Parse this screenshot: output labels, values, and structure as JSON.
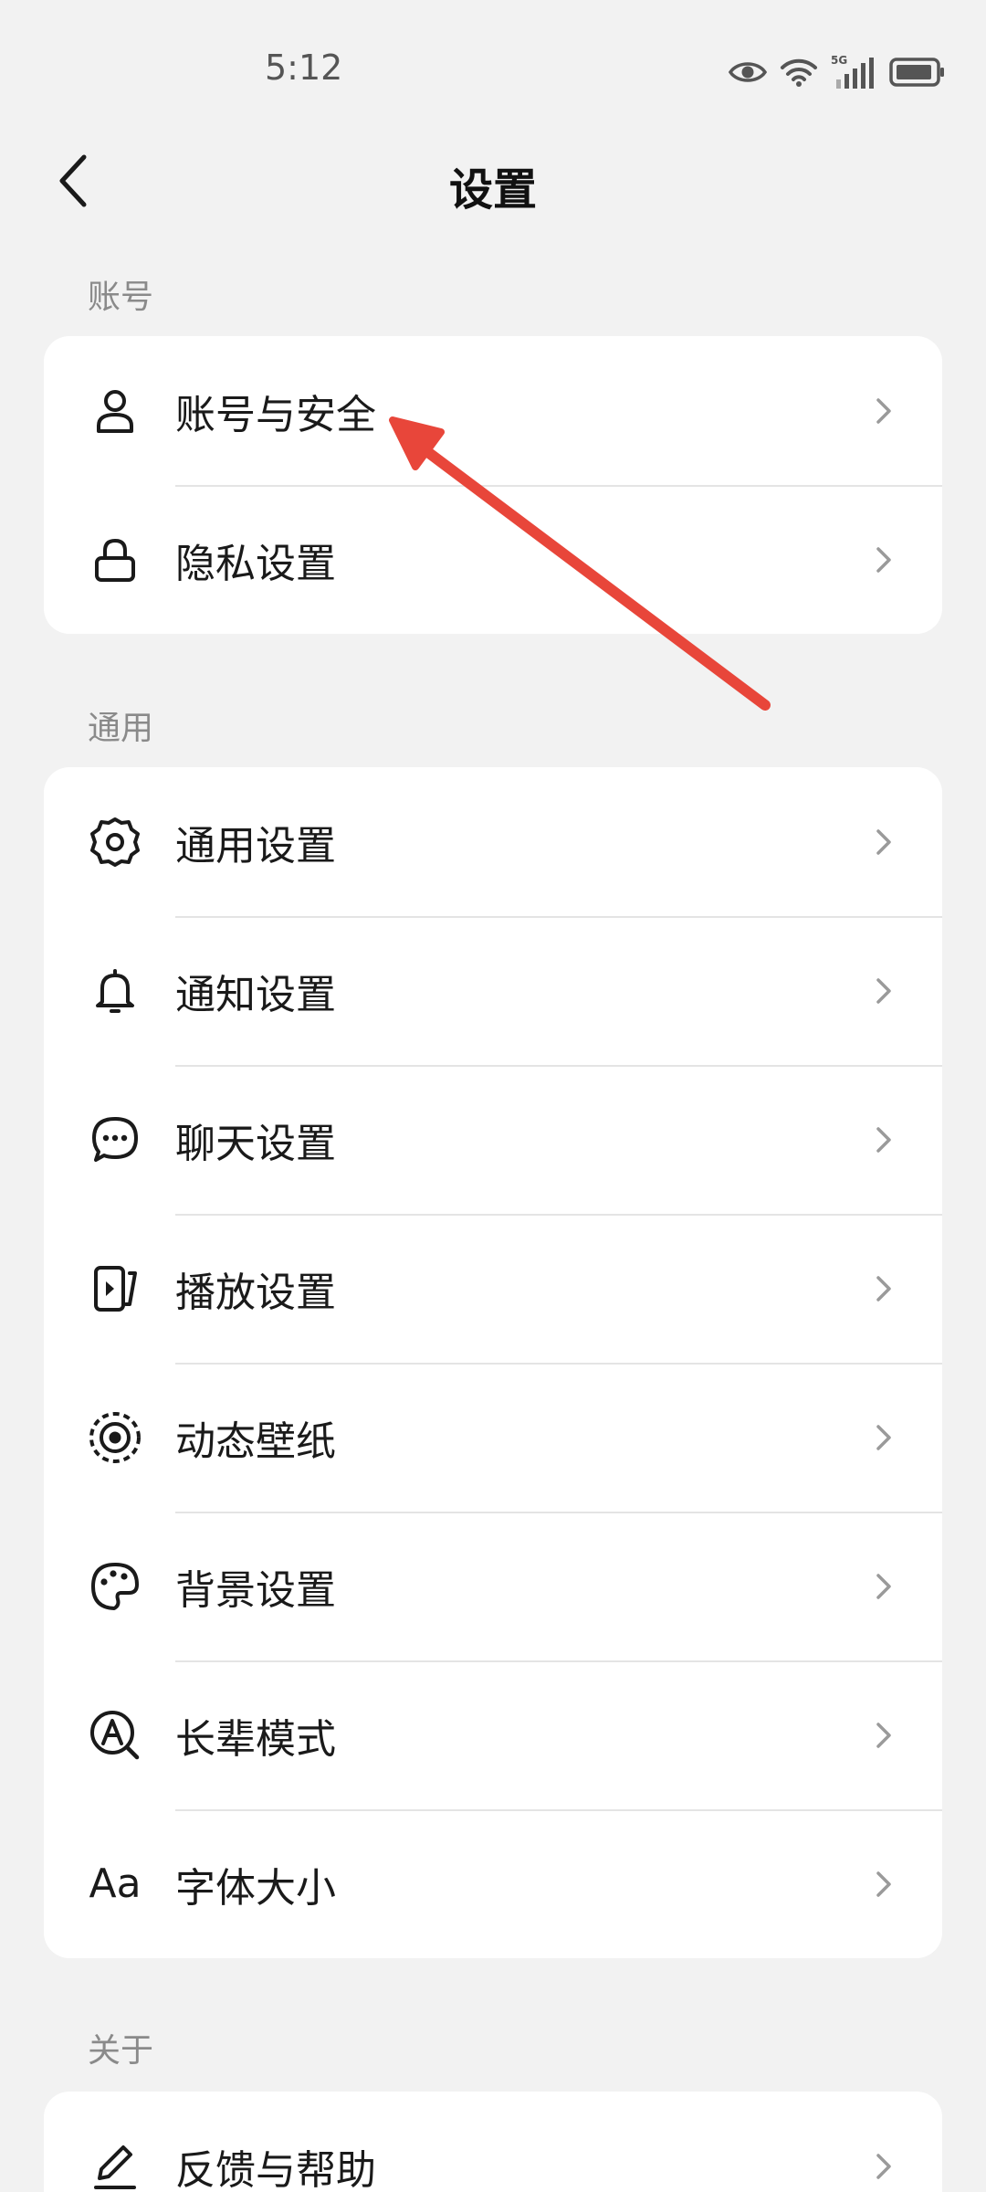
{
  "status_bar": {
    "time": "5:12",
    "network": "5G",
    "icons": [
      "eye-icon",
      "wifi-icon",
      "signal-icon",
      "battery-icon"
    ]
  },
  "nav": {
    "title": "设置",
    "back_icon": "back-arrow-icon"
  },
  "sections": [
    {
      "label": "账号",
      "items": [
        {
          "label": "账号与安全",
          "icon": "person-icon"
        },
        {
          "label": "隐私设置",
          "icon": "lock-icon"
        }
      ]
    },
    {
      "label": "通用",
      "items": [
        {
          "label": "通用设置",
          "icon": "gear-icon"
        },
        {
          "label": "通知设置",
          "icon": "bell-icon"
        },
        {
          "label": "聊天设置",
          "icon": "chat-bubble-icon"
        },
        {
          "label": "播放设置",
          "icon": "play-screen-icon"
        },
        {
          "label": "动态壁纸",
          "icon": "live-wallpaper-icon"
        },
        {
          "label": "背景设置",
          "icon": "palette-icon"
        },
        {
          "label": "长辈模式",
          "icon": "elder-mode-icon"
        },
        {
          "label": "字体大小",
          "icon": "font-size-icon",
          "icon_text": "Aa"
        }
      ]
    },
    {
      "label": "关于",
      "items": [
        {
          "label": "反馈与帮助",
          "icon": "pencil-icon"
        }
      ]
    }
  ],
  "annotation": {
    "type": "arrow",
    "color": "#e8463a",
    "target": "账号与安全"
  },
  "colors": {
    "background": "#f2f2f2",
    "card": "#ffffff",
    "text": "#1a1a1a",
    "section_label": "#8a8a8a",
    "chevron": "#9a9a9a"
  }
}
